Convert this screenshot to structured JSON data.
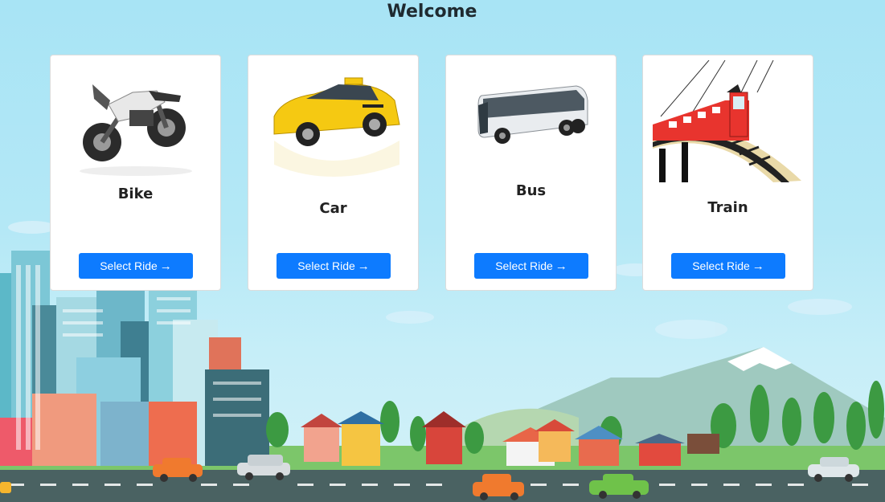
{
  "page": {
    "title": "Welcome"
  },
  "rides": [
    {
      "label": "Bike",
      "button_label": "Select Ride",
      "icon": "motorbike-image"
    },
    {
      "label": "Car",
      "button_label": "Select Ride",
      "icon": "taxi-image"
    },
    {
      "label": "Bus",
      "button_label": "Select Ride",
      "icon": "bus-image"
    },
    {
      "label": "Train",
      "button_label": "Select Ride",
      "icon": "train-image"
    }
  ],
  "colors": {
    "accent": "#0d7bff",
    "sky": "#a8e4f5",
    "road": "#4a6262"
  }
}
